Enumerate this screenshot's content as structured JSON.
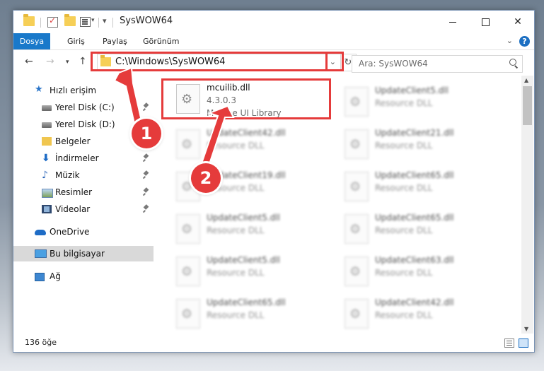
{
  "window": {
    "title": "SysWOW64",
    "controls": {
      "minimize": "—",
      "maximize": "□",
      "close": "✕"
    }
  },
  "ribbon": {
    "tabs": [
      {
        "label": "Dosya",
        "active": true
      },
      {
        "label": "Giriş"
      },
      {
        "label": "Paylaş"
      },
      {
        "label": "Görünüm"
      }
    ],
    "help": "?"
  },
  "navigation": {
    "address": "C:\\Windows\\SysWOW64",
    "search_placeholder": "Ara: SysWOW64"
  },
  "sidebar": {
    "items": [
      {
        "label": "Hızlı erişim",
        "icon": "star-icon"
      },
      {
        "label": "Yerel Disk (C:)",
        "icon": "disk-icon",
        "pinned": true
      },
      {
        "label": "Yerel Disk (D:)",
        "icon": "disk-icon"
      },
      {
        "label": "Belgeler",
        "icon": "folder-icon"
      },
      {
        "label": "İndirmeler",
        "icon": "download-icon",
        "pinned": true
      },
      {
        "label": "Müzik",
        "icon": "music-icon",
        "pinned": true
      },
      {
        "label": "Resimler",
        "icon": "pictures-icon",
        "pinned": true
      },
      {
        "label": "Videolar",
        "icon": "video-icon",
        "pinned": true
      },
      {
        "label": "OneDrive",
        "icon": "cloud-icon"
      },
      {
        "label": "Bu bilgisayar",
        "icon": "pc-icon",
        "selected": true
      },
      {
        "label": "Ağ",
        "icon": "network-icon"
      }
    ]
  },
  "files": {
    "focused": {
      "name": "mcuilib.dll",
      "version": "4.3.0.3",
      "description": "McAfee UI Library"
    },
    "blurred": [
      {
        "name": "UpdateClient5.dll",
        "type": "Resource DLL"
      },
      {
        "name": "UpdateClient42.dll",
        "type": "Resource DLL"
      },
      {
        "name": "UpdateClient21.dll",
        "type": "Resource DLL"
      },
      {
        "name": "UpdateClient19.dll",
        "type": "Resource DLL"
      },
      {
        "name": "UpdateClient65.dll",
        "type": "Resource DLL"
      },
      {
        "name": "UpdateClient5.dll",
        "type": "Resource DLL"
      },
      {
        "name": "UpdateClient65.dll",
        "type": "Resource DLL"
      },
      {
        "name": "UpdateClient5.dll",
        "type": "Resource DLL"
      },
      {
        "name": "UpdateClient63.dll",
        "type": "Resource DLL"
      },
      {
        "name": "UpdateClient65.dll",
        "type": "Resource DLL"
      },
      {
        "name": "UpdateClient42.dll",
        "type": "Resource DLL"
      }
    ]
  },
  "status": {
    "count": "136 öğe"
  },
  "callouts": {
    "step1": "1",
    "step2": "2",
    "color": "#e53b3b"
  }
}
